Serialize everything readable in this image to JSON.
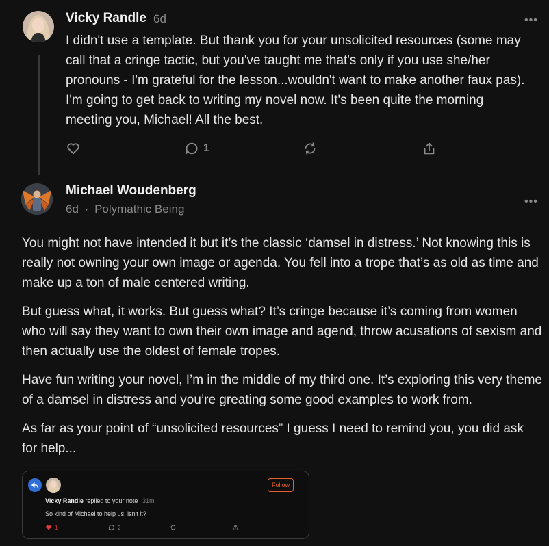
{
  "comments": [
    {
      "author": "Vicky Randle",
      "age": "6d",
      "text": "I didn't use a template. But thank you for your unsolicited resources (some may call that a cringe tactic, but you've taught me that's only if you use she/her pronouns - I'm grateful for the lesson...wouldn't want to make another faux pas). I'm going to get back to writing my novel now. It's been quite the morning meeting you, Michael! All the best.",
      "actions": {
        "like_icon": "heart-icon",
        "comment_icon": "comment-icon",
        "comment_count": "1",
        "restack_icon": "restack-icon",
        "share_icon": "share-icon"
      }
    },
    {
      "author": "Michael Woudenberg",
      "age": "6d",
      "separator": "·",
      "publication": "Polymathic Being",
      "paragraphs": [
        "You might not have intended it but it’s the classic ‘damsel in distress.’ Not knowing this is really not owning your own image or agenda. You fell into a trope that’s as old as time and make up a ton of male centered writing.",
        "But guess what, it works. But guess what? It’s cringe because it’s coming from women who will say they want to own their own image and agend, throw acusations of sexism and then actually use the oldest of female tropes.",
        "Have fun writing your novel, I’m in the middle of my third one. It’s exploring this very theme of a damsel in distress and you’re greating some good examples to work from.",
        "As far as your point of “unsolicited resources” I guess I need to remind you, you did ask for help..."
      ]
    }
  ],
  "embedded_card": {
    "follow_label": "Follow",
    "author": "Vicky Randle",
    "replied_text": "replied to your note",
    "ago": "31m",
    "note": "So kind of Michael to help us, isn't it?",
    "like_count": "1",
    "comment_count": "2"
  },
  "more_glyph": "•••",
  "colors": {
    "background": "#111111",
    "text": "#e6e6e6",
    "muted": "#8a8a8a",
    "accent": "#e8612c",
    "like": "#e5383b"
  }
}
